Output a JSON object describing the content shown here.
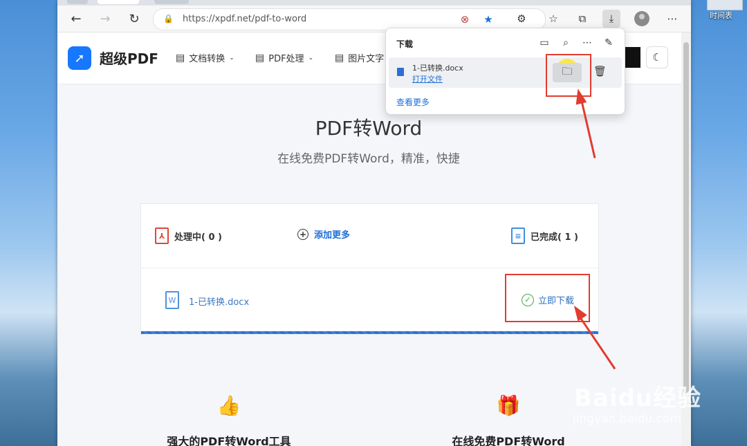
{
  "desktop": {
    "icon_label": "时间表"
  },
  "browser": {
    "url": "https://xpdf.net/pdf-to-word",
    "icons": [
      "back-icon",
      "forward-icon",
      "refresh-icon",
      "lock-icon",
      "tracking-icon",
      "favorite-star-icon",
      "extensions-icon",
      "favorites-icon",
      "collections-icon",
      "download-icon",
      "profile-icon",
      "more-icon"
    ]
  },
  "site": {
    "logo": "超级PDF",
    "nav": [
      "文档转换",
      "PDF处理",
      "图片文字"
    ],
    "title": "PDF转Word",
    "subtitle": "在线免费PDF转Word，精准，快捷"
  },
  "card": {
    "processing": "处理中( 0 )",
    "add_more": "添加更多",
    "completed": "已完成( 1 )",
    "file_name": "1-已转换.docx",
    "download_now": "立即下载"
  },
  "features": [
    {
      "icon": "thumbs-up-icon",
      "text": "强大的PDF转Word工具"
    },
    {
      "icon": "gift-icon",
      "text": "在线免费PDF转Word"
    }
  ],
  "downloads_panel": {
    "title": "下载",
    "file_name": "1-已转换.docx",
    "open_file": "打开文件",
    "see_more": "查看更多"
  },
  "watermark": {
    "main": "Baidu经验",
    "sub": "jingyan.baidu.com"
  },
  "colors": {
    "accent": "#1677ff",
    "annotation": "#e23b2f",
    "link": "#1d6fd9"
  }
}
